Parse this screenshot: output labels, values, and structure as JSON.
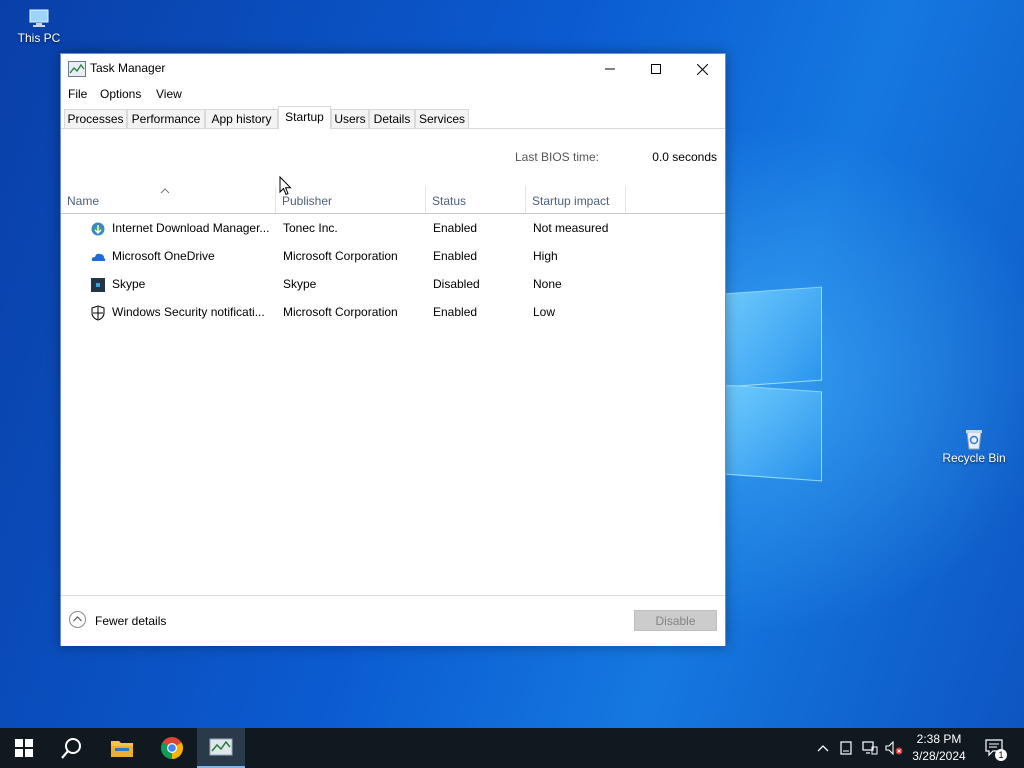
{
  "desktop": {
    "icons": [
      {
        "label": "This PC"
      },
      {
        "label": "Recycle Bin"
      }
    ]
  },
  "window": {
    "title": "Task Manager",
    "controls": {
      "minimize": "minimize-icon",
      "maximize": "maximize-icon",
      "close": "close-icon"
    }
  },
  "menu": {
    "items": [
      "File",
      "Options",
      "View"
    ]
  },
  "tabs": [
    {
      "label": "Processes"
    },
    {
      "label": "Performance"
    },
    {
      "label": "App history"
    },
    {
      "label": "Startup",
      "active": true
    },
    {
      "label": "Users"
    },
    {
      "label": "Details"
    },
    {
      "label": "Services"
    }
  ],
  "bios": {
    "label": "Last BIOS time:",
    "value": "0.0 seconds"
  },
  "columns": [
    "Name",
    "Publisher",
    "Status",
    "Startup impact"
  ],
  "rows": [
    {
      "name": "Internet Download Manager...",
      "publisher": "Tonec Inc.",
      "status": "Enabled",
      "impact": "Not measured",
      "icon": "idm-icon"
    },
    {
      "name": "Microsoft OneDrive",
      "publisher": "Microsoft Corporation",
      "status": "Enabled",
      "impact": "High",
      "icon": "onedrive-icon"
    },
    {
      "name": "Skype",
      "publisher": "Skype",
      "status": "Disabled",
      "impact": "None",
      "icon": "skype-icon"
    },
    {
      "name": "Windows Security notificati...",
      "publisher": "Microsoft Corporation",
      "status": "Enabled",
      "impact": "Low",
      "icon": "shield-icon"
    }
  ],
  "footer": {
    "fewer_details": "Fewer details",
    "disable": "Disable"
  },
  "taskbar": {
    "time": "2:38 PM",
    "date": "3/28/2024",
    "notifications": "1"
  },
  "colors": {
    "accent": "#0078d7",
    "taskbar": "#101820",
    "header_text": "#4c607a"
  }
}
